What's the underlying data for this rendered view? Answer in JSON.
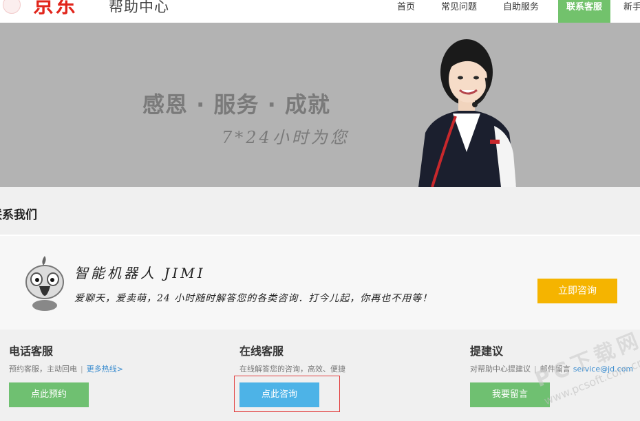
{
  "header": {
    "logo_text": "京东",
    "site_title": "帮助中心",
    "nav": [
      {
        "label": "首页",
        "active": false
      },
      {
        "label": "常见问题",
        "active": false
      },
      {
        "label": "自助服务",
        "active": false
      },
      {
        "label": "联系客服",
        "active": true
      },
      {
        "label": "新手",
        "active": false
      }
    ]
  },
  "banner": {
    "slogan": "感恩 · 服务 · 成就",
    "sub_slogan": "7*24小时为您"
  },
  "section": {
    "title": "联系我们"
  },
  "robot": {
    "title": "智能机器人 JIMI",
    "description": "爱聊天，爱卖萌，24 小时随时解答您的各类咨询．打今儿起，你再也不用等！",
    "button": "立即咨询"
  },
  "services": [
    {
      "title": "电话客服",
      "desc": "预约客服，主动回电",
      "link": "更多热线>",
      "button": "点此预约"
    },
    {
      "title": "在线客服",
      "desc": "在线解答您的咨询，高效、便捷",
      "button": "点此咨询"
    },
    {
      "title": "提建议",
      "desc": "对帮助中心提建议",
      "desc2": "邮件留言",
      "email": "service@jd.com",
      "button": "我要留言"
    }
  ],
  "watermark": {
    "main": "PC下载网",
    "url": "www.pcsoft.com.cn"
  },
  "colors": {
    "brand_red": "#e1251b",
    "nav_active": "#72c26c",
    "banner_bg": "#b3b3b3",
    "button_yellow": "#f5b400",
    "button_green": "#6fc071",
    "button_blue": "#4db3e7",
    "link_blue": "#3a8ccf",
    "highlight_red": "#e23c3c"
  }
}
